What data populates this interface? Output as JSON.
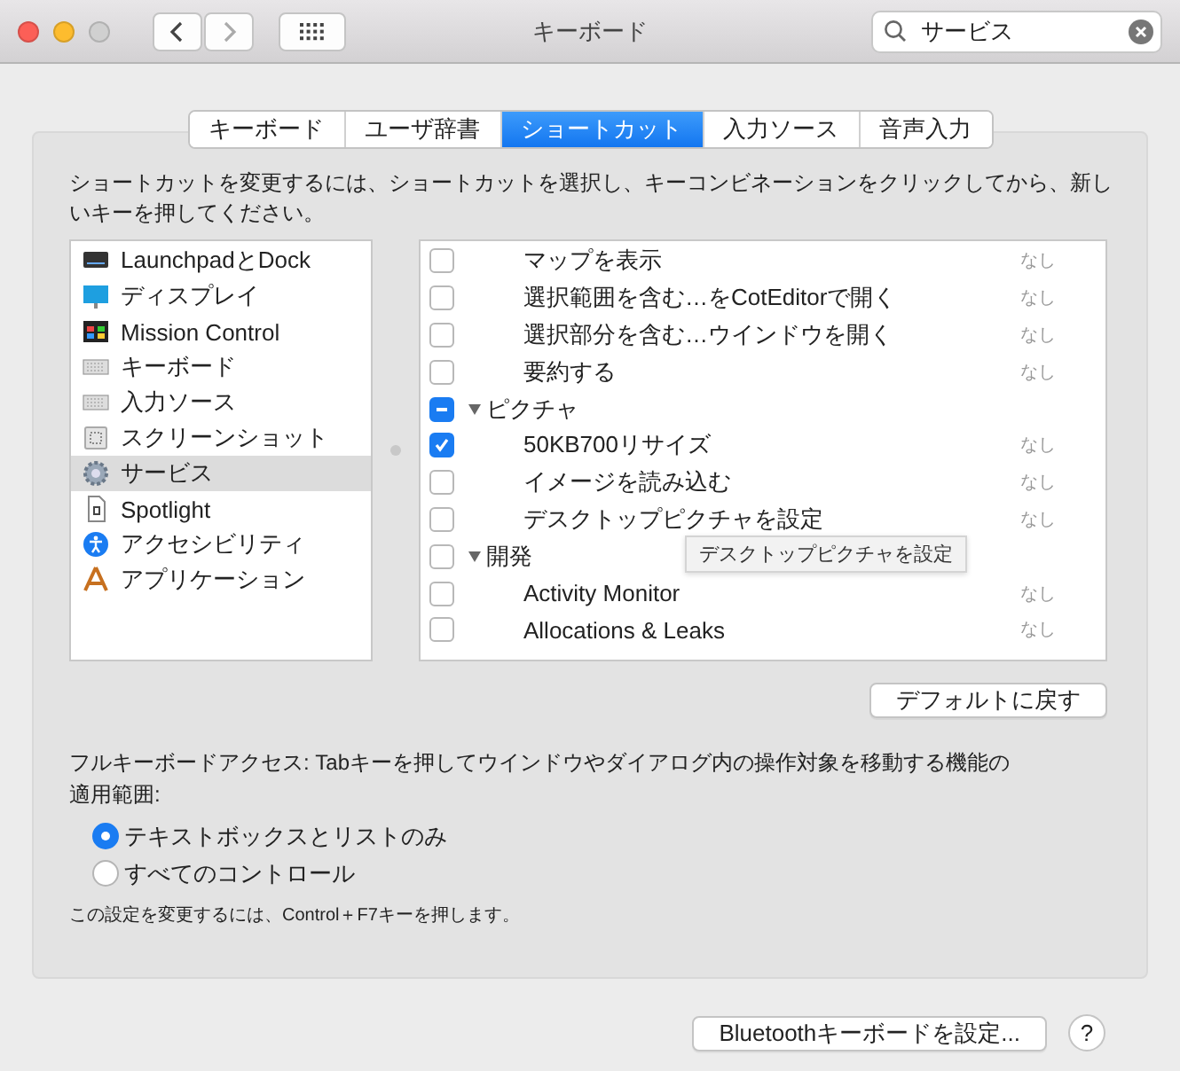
{
  "window": {
    "title": "キーボード"
  },
  "search": {
    "value": "サービス"
  },
  "tabs": [
    {
      "label": "キーボード",
      "selected": false
    },
    {
      "label": "ユーザ辞書",
      "selected": false
    },
    {
      "label": "ショートカット",
      "selected": true
    },
    {
      "label": "入力ソース",
      "selected": false
    },
    {
      "label": "音声入力",
      "selected": false
    }
  ],
  "description": "ショートカットを変更するには、ショートカットを選択し、キーコンビネーションをクリックしてから、新しいキーを押してください。",
  "sidebar": {
    "items": [
      {
        "kind": "dock",
        "label": "LaunchpadとDock",
        "selected": false
      },
      {
        "kind": "display",
        "label": "ディスプレイ",
        "selected": false
      },
      {
        "kind": "mission",
        "label": "Mission Control",
        "selected": false
      },
      {
        "kind": "keyboard",
        "label": "キーボード",
        "selected": false
      },
      {
        "kind": "keyboard",
        "label": "入力ソース",
        "selected": false
      },
      {
        "kind": "screenshot",
        "label": "スクリーンショット",
        "selected": false
      },
      {
        "kind": "gear",
        "label": "サービス",
        "selected": true
      },
      {
        "kind": "spotlight",
        "label": "Spotlight",
        "selected": false
      },
      {
        "kind": "accessibility",
        "label": "アクセシビリティ",
        "selected": false
      },
      {
        "kind": "apps",
        "label": "アプリケーション",
        "selected": false
      }
    ]
  },
  "shortcuts": [
    {
      "kind": "item",
      "checked": false,
      "label": "マップを表示",
      "key": "なし"
    },
    {
      "kind": "item",
      "checked": false,
      "label": "選択範囲を含む…をCotEditorで開く",
      "key": "なし"
    },
    {
      "kind": "item",
      "checked": false,
      "label": "選択部分を含む…ウインドウを開く",
      "key": "なし"
    },
    {
      "kind": "item",
      "checked": false,
      "label": "要約する",
      "key": "なし"
    },
    {
      "kind": "group",
      "mixed": true,
      "label": "ピクチャ",
      "expanded": true
    },
    {
      "kind": "item",
      "checked": true,
      "label": "50KB700リサイズ",
      "key": "なし"
    },
    {
      "kind": "item",
      "checked": false,
      "label": "イメージを読み込む",
      "key": "なし"
    },
    {
      "kind": "item",
      "checked": false,
      "label": "デスクトップピクチャを設定",
      "key": "なし"
    },
    {
      "kind": "group",
      "mixed": false,
      "label": "開発",
      "expanded": true
    },
    {
      "kind": "item",
      "checked": false,
      "label": "Activity Monitor",
      "key": "なし"
    },
    {
      "kind": "item",
      "checked": false,
      "label": "Allocations & Leaks",
      "key": "なし"
    }
  ],
  "tooltip": "デスクトップピクチャを設定",
  "default_button": "デフォルトに戻す",
  "full_access": {
    "text": "フルキーボードアクセス: Tabキーを押してウインドウやダイアログ内の操作対象を移動する機能の適用範囲:",
    "options": [
      {
        "label": "テキストボックスとリストのみ",
        "selected": true
      },
      {
        "label": "すべてのコントロール",
        "selected": false
      }
    ],
    "note": "この設定を変更するには、Control＋F7キーを押します。"
  },
  "bluetooth_button": "Bluetoothキーボードを設定...",
  "help_button": "?"
}
